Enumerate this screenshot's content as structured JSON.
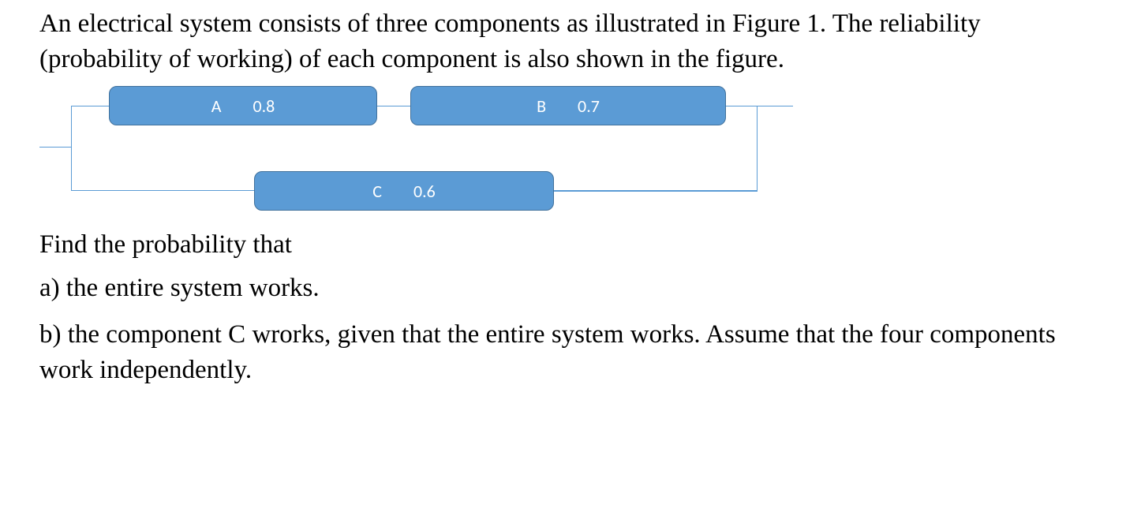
{
  "problem": {
    "intro": " An electrical system consists of three components as illustrated in Figure 1. The reliability (probability of working) of each component is also shown in the figure."
  },
  "components": {
    "a": {
      "label": "A",
      "value": "0.8"
    },
    "b": {
      "label": "B",
      "value": "0.7"
    },
    "c": {
      "label": "C",
      "value": "0.6"
    }
  },
  "questions": {
    "find": "Find the probability that",
    "a": "a) the entire system works.",
    "b": "b) the component C wrorks, given that the entire system works. Assume that the four components work independently."
  }
}
